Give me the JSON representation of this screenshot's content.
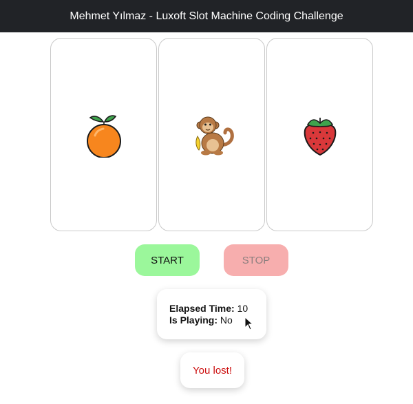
{
  "header": {
    "title": "Mehmet Yılmaz - Luxoft Slot Machine Coding Challenge"
  },
  "reels": [
    {
      "icon": "orange-icon"
    },
    {
      "icon": "monkey-icon"
    },
    {
      "icon": "strawberry-icon"
    }
  ],
  "controls": {
    "start_label": "START",
    "stop_label": "STOP"
  },
  "status": {
    "elapsed_label": "Elapsed Time:",
    "elapsed_value": "10",
    "playing_label": "Is Playing:",
    "playing_value": "No"
  },
  "result": {
    "text": "You lost!"
  },
  "colors": {
    "header_bg": "#212327",
    "start_bg": "#9bf79b",
    "stop_bg": "#f7aeae",
    "result_text": "#cc0e0e"
  }
}
